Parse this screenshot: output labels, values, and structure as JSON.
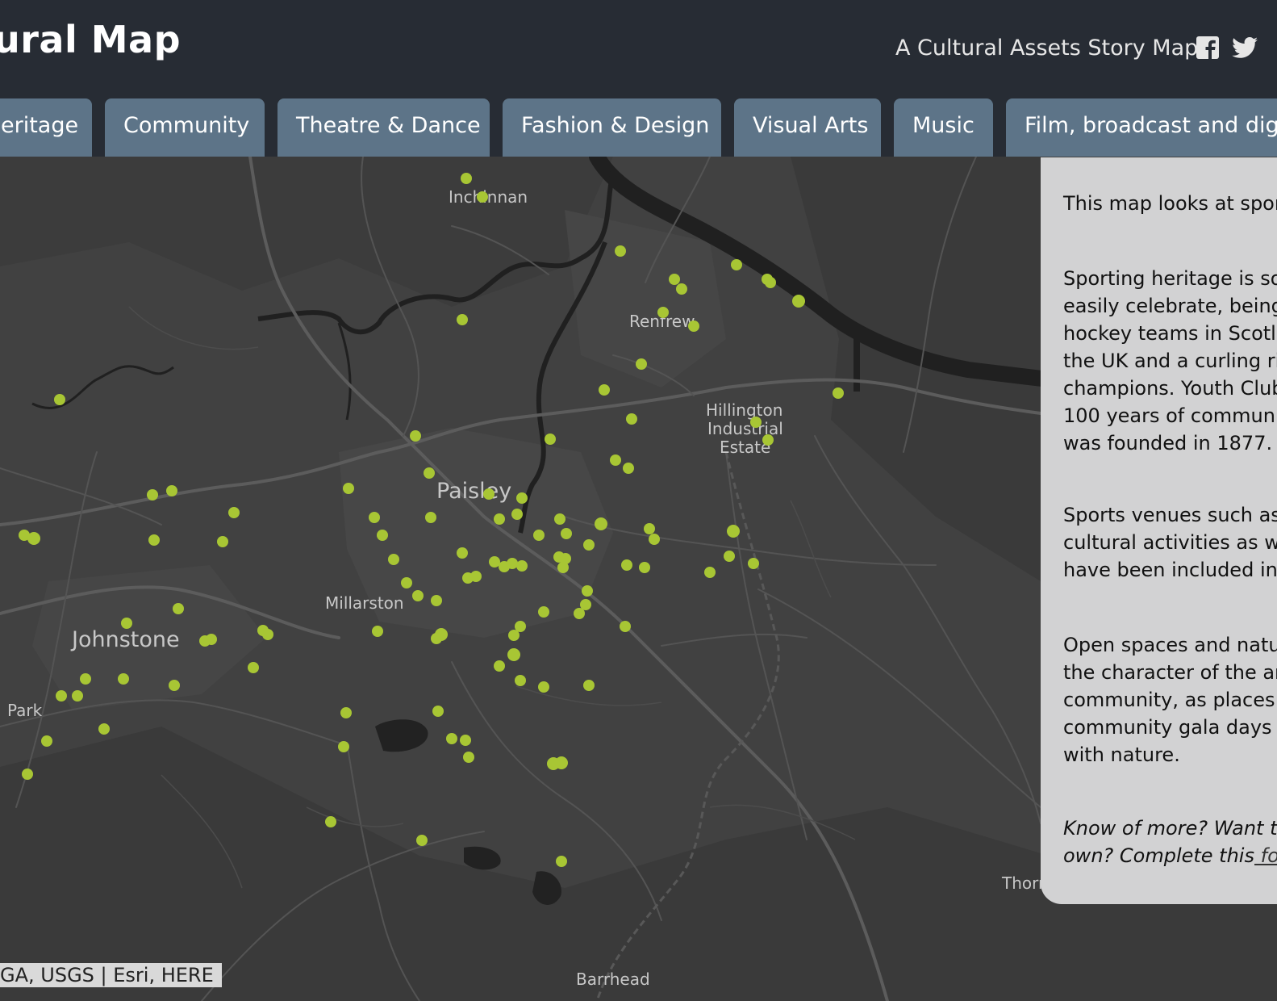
{
  "header": {
    "title": "ural Map",
    "subtitle": "A Cultural Assets Story Map",
    "social": [
      {
        "icon": "facebook-icon"
      },
      {
        "icon": "twitter-icon"
      }
    ]
  },
  "tabs": [
    {
      "label": "eritage"
    },
    {
      "label": "Community"
    },
    {
      "label": "Theatre & Dance"
    },
    {
      "label": "Fashion & Design"
    },
    {
      "label": "Visual Arts"
    },
    {
      "label": "Music"
    },
    {
      "label": "Film, broadcast and dig"
    }
  ],
  "colors": {
    "header_bg": "#272c34",
    "tab_bg": "#5d7488",
    "map_bg": "#414141",
    "marker": "#a8c634",
    "panel_bg": "#d2d2d3"
  },
  "map": {
    "labels": {
      "inchinnan": "Inchinnan",
      "renfrew": "Renfrew",
      "hillington_1": "Hillington",
      "hillington_2": "Industrial",
      "hillington_3": "Estate",
      "paisley": "Paisley",
      "millarston": "Millarston",
      "johnstone": "Johnstone",
      "park": "Park",
      "thornliebank": "Thornliebank",
      "barrhead": "Barrhead"
    },
    "attribution": "GA, USGS | Esri, HERE"
  },
  "panel": {
    "p1": "This map looks at spor",
    "p2": "Sporting heritage is sor\neasily celebrate, being\nhockey teams in Scotla\nthe UK and a curling rir\nchampions. Youth Club\n100 years of communit\nwas founded in 1877.",
    "p3": "Sports venues such as\ncultural activities as we\nhave been included in",
    "p4": "Open spaces and natur\nthe character of the are\ncommunity, as places t\ncommunity gala days c\nwith nature.",
    "p5_line1": "Know of more? Want t",
    "p5_line2": "own? Complete this",
    "p5_link": " fo"
  }
}
